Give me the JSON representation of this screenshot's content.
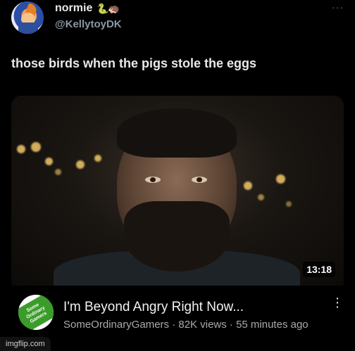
{
  "post": {
    "display_name": "normie",
    "name_emoji": "🐍🦔",
    "handle": "@KellytoyDK",
    "more_icon": "···",
    "text": "those birds when the pigs stole the eggs"
  },
  "video": {
    "duration": "13:18",
    "title": "I'm Beyond Angry Right Now...",
    "channel_avatar_text": "Some Ordinary Gamers",
    "meta": "SomeOrdinaryGamers · 82K views · 55 minutes ago",
    "menu_icon": "⋮"
  },
  "watermark": "imgflip.com",
  "colors": {
    "background": "#000000",
    "text_primary": "#e7e9ea",
    "text_secondary": "#8b98a5",
    "channel_green": "#3b9c2a"
  }
}
